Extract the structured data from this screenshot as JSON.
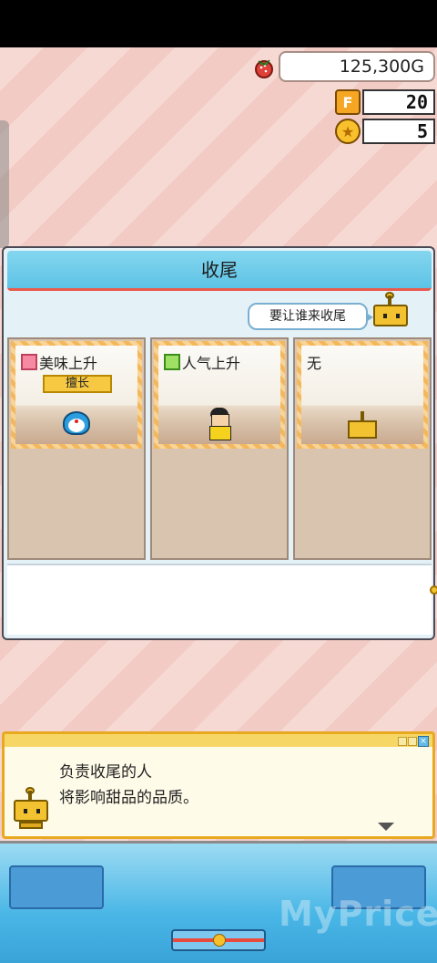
{
  "resources": {
    "gold": "125,300G",
    "f_points": "20",
    "coins": "5",
    "f_icon_letter": "F",
    "coin_icon_symbol": "★"
  },
  "panel": {
    "title": "收尾",
    "prompt": "要让谁来收尾",
    "slots": [
      {
        "label": "美味上升",
        "trait_icon": "taste-icon",
        "tag": "擅长",
        "character": "doraemon"
      },
      {
        "label": "人气上升",
        "trait_icon": "popularity-icon",
        "tag": "",
        "character": "nobita"
      },
      {
        "label": "无",
        "trait_icon": "",
        "tag": "",
        "character": "robot"
      }
    ]
  },
  "dialog": {
    "line1": "负责收尾的人",
    "line2": "将影响甜品的品质。",
    "close_glyph": "×"
  },
  "watermark": "MyPrice",
  "colors": {
    "title_bar": "#5dc3e6",
    "accent_red": "#e95a4d",
    "tag_yellow": "#f7c943",
    "dialog_border": "#e8a820"
  }
}
